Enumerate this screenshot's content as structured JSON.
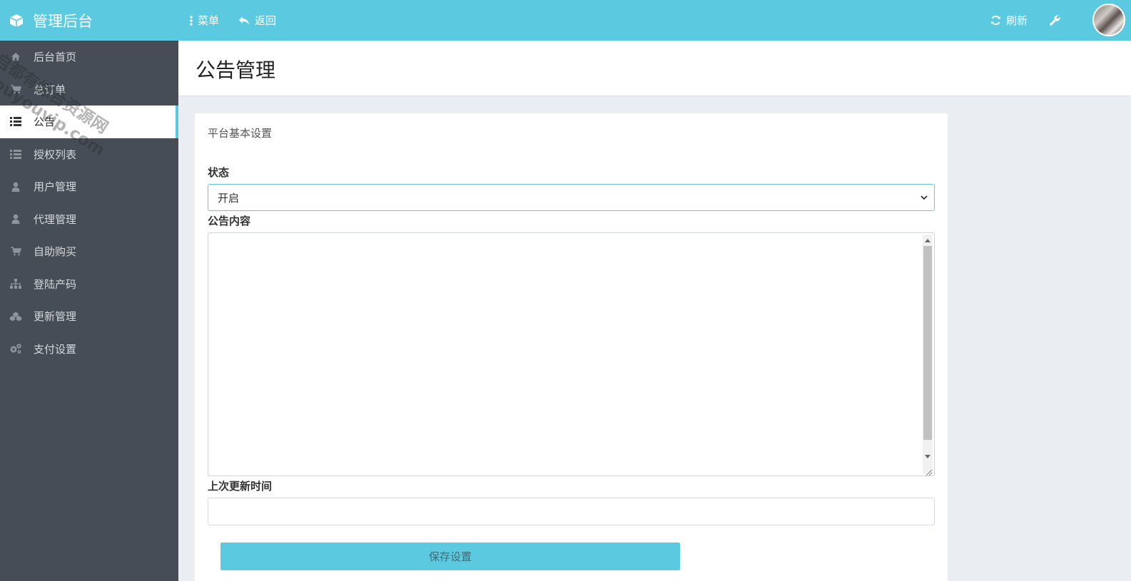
{
  "app": {
    "title": "管理后台"
  },
  "topbar": {
    "menu_label": "菜单",
    "back_label": "返回",
    "refresh_label": "刷新"
  },
  "sidebar": {
    "items": [
      {
        "label": "后台首页",
        "icon": "home-icon"
      },
      {
        "label": "总订单",
        "icon": "cart-icon"
      },
      {
        "label": "公告",
        "icon": "list-icon",
        "active": true
      },
      {
        "label": "授权列表",
        "icon": "list-icon"
      },
      {
        "label": "用户管理",
        "icon": "user-icon"
      },
      {
        "label": "代理管理",
        "icon": "user-icon"
      },
      {
        "label": "自助购买",
        "icon": "cart-icon"
      },
      {
        "label": "登陆产码",
        "icon": "sitemap-icon"
      },
      {
        "label": "更新管理",
        "icon": "cubes-icon"
      },
      {
        "label": "支付设置",
        "icon": "cogs-icon"
      }
    ]
  },
  "page": {
    "title": "公告管理"
  },
  "form": {
    "heading": "平台基本设置",
    "status_label": "状态",
    "status_value": "开启",
    "content_label": "公告内容",
    "content_value": "",
    "updated_label": "上次更新时间",
    "updated_value": "",
    "save_label": "保存设置"
  },
  "watermark": {
    "line1": "自都有综合资源网",
    "line2": "douyouvip.com"
  },
  "colors": {
    "accent": "#5bc9df",
    "sidebar_bg": "#464d57"
  }
}
